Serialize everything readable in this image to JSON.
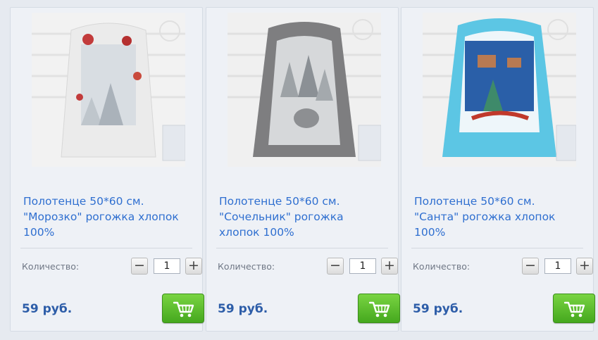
{
  "products": [
    {
      "title_line1": "Полотенце 50*60 см.",
      "title_line2": "\"Морозко\" рогожка хлопок",
      "title_line3": "100%",
      "qty_label": "Количество:",
      "quantity": "1",
      "price": "59 руб.",
      "image_icon": "towel-morozko-image"
    },
    {
      "title_line1": "Полотенце 50*60 см.",
      "title_line2": "\"Сочельник\" рогожка",
      "title_line3": "хлопок 100%",
      "qty_label": "Количество:",
      "quantity": "1",
      "price": "59 руб.",
      "image_icon": "towel-sochelnik-image"
    },
    {
      "title_line1": "Полотенце 50*60 см.",
      "title_line2": "\"Санта\" рогожка хлопок",
      "title_line3": "100%",
      "qty_label": "Количество:",
      "quantity": "1",
      "price": "59 руб.",
      "image_icon": "towel-santa-image"
    }
  ],
  "controls": {
    "minus_symbol": "−",
    "plus_symbol": "+"
  },
  "colors": {
    "title_link": "#2f6fd0",
    "price": "#2d5da8",
    "cart_button": "#52b427"
  }
}
